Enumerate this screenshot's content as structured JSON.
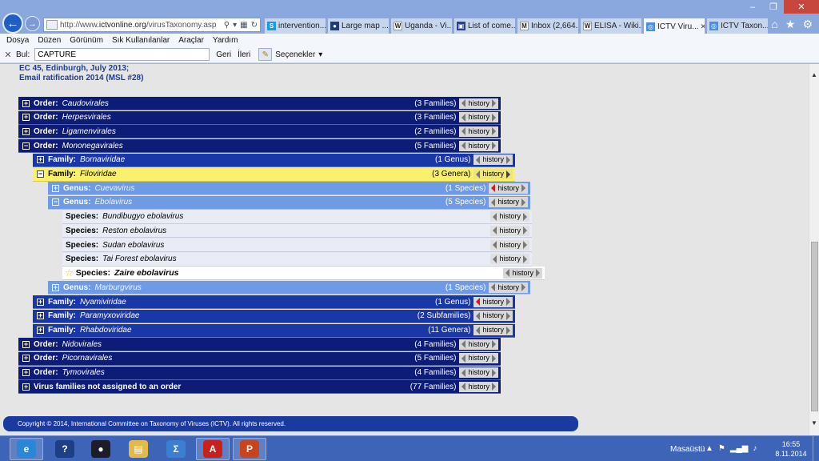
{
  "browser": {
    "url_prefix": "http://www.",
    "url_domain": "ictvonline.org",
    "url_path": "/virusTaxonomy.asp",
    "tabs": [
      {
        "label": "intervention...",
        "icon": "skype-icon",
        "color": "#1a9be0",
        "glyph": "S"
      },
      {
        "label": "Large map ...",
        "icon": "globe-icon",
        "color": "#1f3e78",
        "glyph": "●"
      },
      {
        "label": "Uganda - Vi...",
        "icon": "wikipedia-icon",
        "color": "#ffffff",
        "glyph": "W"
      },
      {
        "label": "List of come...",
        "icon": "document-icon",
        "color": "#2a3f9a",
        "glyph": "▣"
      },
      {
        "label": "Inbox (2,664...",
        "icon": "gmail-icon",
        "color": "#ffffff",
        "glyph": "M"
      },
      {
        "label": "ELISA - Wiki...",
        "icon": "wikipedia-icon",
        "color": "#ffffff",
        "glyph": "W"
      },
      {
        "label": "ICTV Viru...",
        "icon": "ictv-icon",
        "color": "#4c8ee0",
        "glyph": "◎",
        "active": true
      },
      {
        "label": "ICTV Taxon...",
        "icon": "ictv-icon",
        "color": "#4c8ee0",
        "glyph": "◎"
      }
    ],
    "menu": [
      "Dosya",
      "Düzen",
      "Görünüm",
      "Sık Kullanılanlar",
      "Araçlar",
      "Yardım"
    ],
    "find": {
      "label": "Bul:",
      "value": "CAPTURE",
      "prev": "Geri",
      "next": "İleri",
      "options": "Seçenekler"
    }
  },
  "page": {
    "meta_lines": [
      "EC 45, Edinburgh, July 2013;",
      "Email ratification 2014 (MSL #28)"
    ],
    "history_label": "history",
    "footer": "Copyright © 2014, International Committee on Taxonomy of Viruses (ICTV).   All rights reserved."
  },
  "tree": [
    {
      "kind": "order",
      "rank": "Order:",
      "name": "Caudovirales",
      "count": "(3 Families)",
      "expanded": false
    },
    {
      "kind": "order",
      "rank": "Order:",
      "name": "Herpesvirales",
      "count": "(3 Families)",
      "expanded": false
    },
    {
      "kind": "order",
      "rank": "Order:",
      "name": "Ligamenvirales",
      "count": "(2 Families)",
      "expanded": false
    },
    {
      "kind": "order",
      "rank": "Order:",
      "name": "Mononegavirales",
      "count": "(5 Families)",
      "expanded": true
    },
    {
      "kind": "family",
      "rank": "Family:",
      "name": "Bornaviridae",
      "count": "(1 Genus)",
      "expanded": false
    },
    {
      "kind": "family-hl",
      "rank": "Family:",
      "name": "Filoviridae",
      "count": "(3 Genera)",
      "expanded": true
    },
    {
      "kind": "genus",
      "rank": "Genus:",
      "name": "Cuevavirus",
      "count": "(1 Species)",
      "expanded": false,
      "red_history": true
    },
    {
      "kind": "genus",
      "rank": "Genus:",
      "name": "Ebolavirus",
      "count": "(5 Species)",
      "expanded": true
    },
    {
      "kind": "species",
      "rank": "Species:",
      "name": "Bundibugyo ebolavirus",
      "count": ""
    },
    {
      "kind": "species",
      "rank": "Species:",
      "name": "Reston ebolavirus",
      "count": ""
    },
    {
      "kind": "species",
      "rank": "Species:",
      "name": "Sudan ebolavirus",
      "count": ""
    },
    {
      "kind": "species",
      "rank": "Species:",
      "name": "Tai Forest ebolavirus",
      "count": ""
    },
    {
      "kind": "species-sel",
      "rank": "Species:",
      "name": "Zaire ebolavirus",
      "count": "",
      "starred": true
    },
    {
      "kind": "genus",
      "rank": "Genus:",
      "name": "Marburgvirus",
      "count": "(1 Species)",
      "expanded": false
    },
    {
      "kind": "family",
      "rank": "Family:",
      "name": "Nyamiviridae",
      "count": "(1 Genus)",
      "expanded": false,
      "red_history": true
    },
    {
      "kind": "family",
      "rank": "Family:",
      "name": "Paramyxoviridae",
      "count": "(2 Subfamilies)",
      "expanded": false
    },
    {
      "kind": "family",
      "rank": "Family:",
      "name": "Rhabdoviridae",
      "count": "(11 Genera)",
      "expanded": false
    },
    {
      "kind": "order",
      "rank": "Order:",
      "name": "Nidovirales",
      "count": "(4 Families)",
      "expanded": false
    },
    {
      "kind": "order",
      "rank": "Order:",
      "name": "Picornavirales",
      "count": "(5 Families)",
      "expanded": false
    },
    {
      "kind": "order",
      "rank": "Order:",
      "name": "Tymovirales",
      "count": "(4 Families)",
      "expanded": false
    },
    {
      "kind": "order",
      "rank": "Virus families not assigned to an order",
      "name": "",
      "count": "(77 Families)",
      "expanded": false
    }
  ],
  "taskbar": {
    "apps": [
      {
        "name": "internet-explorer-icon",
        "glyph": "e",
        "color": "#2a86d8",
        "active": true
      },
      {
        "name": "help-icon",
        "glyph": "?",
        "color": "#1e3f86"
      },
      {
        "name": "media-icon",
        "glyph": "●",
        "color": "#1d1d2a"
      },
      {
        "name": "folder-icon",
        "glyph": "▤",
        "color": "#e3b94a"
      },
      {
        "name": "math-icon",
        "glyph": "Σ",
        "color": "#3a7fd0"
      },
      {
        "name": "acrobat-icon",
        "glyph": "A",
        "color": "#c8201b",
        "active": true
      },
      {
        "name": "powerpoint-icon",
        "glyph": "P",
        "color": "#c9431d",
        "active": true
      }
    ],
    "desktop_label": "Masaüstü",
    "time": "16:55",
    "date": "8.11.2014"
  }
}
